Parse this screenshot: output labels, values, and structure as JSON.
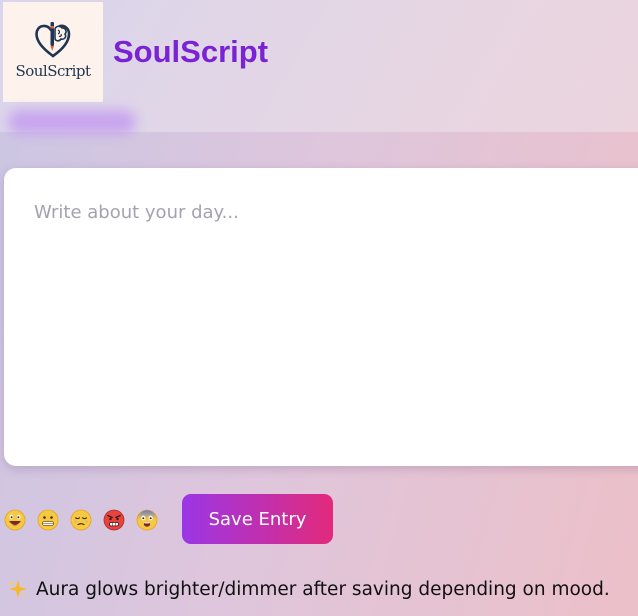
{
  "header": {
    "logo_text": "SoulScript",
    "app_title": "SoulScript"
  },
  "journal": {
    "placeholder": "Write about your day..."
  },
  "moods": [
    {
      "name": "happy-emoji-icon",
      "face": "grin"
    },
    {
      "name": "neutral-emoji-icon",
      "face": "grimace"
    },
    {
      "name": "sad-emoji-icon",
      "face": "pensive"
    },
    {
      "name": "angry-emoji-icon",
      "face": "angry"
    },
    {
      "name": "anxious-emoji-icon",
      "face": "fearful"
    }
  ],
  "actions": {
    "save_label": "Save Entry"
  },
  "info": {
    "icon": "sparkles-icon",
    "text": "Aura glows brighter/dimmer after saving depending on mood."
  },
  "colors": {
    "accent": "#7a22d4",
    "button_start": "#9b36e6",
    "button_end": "#e22a7c",
    "aura": "#c59df0"
  }
}
